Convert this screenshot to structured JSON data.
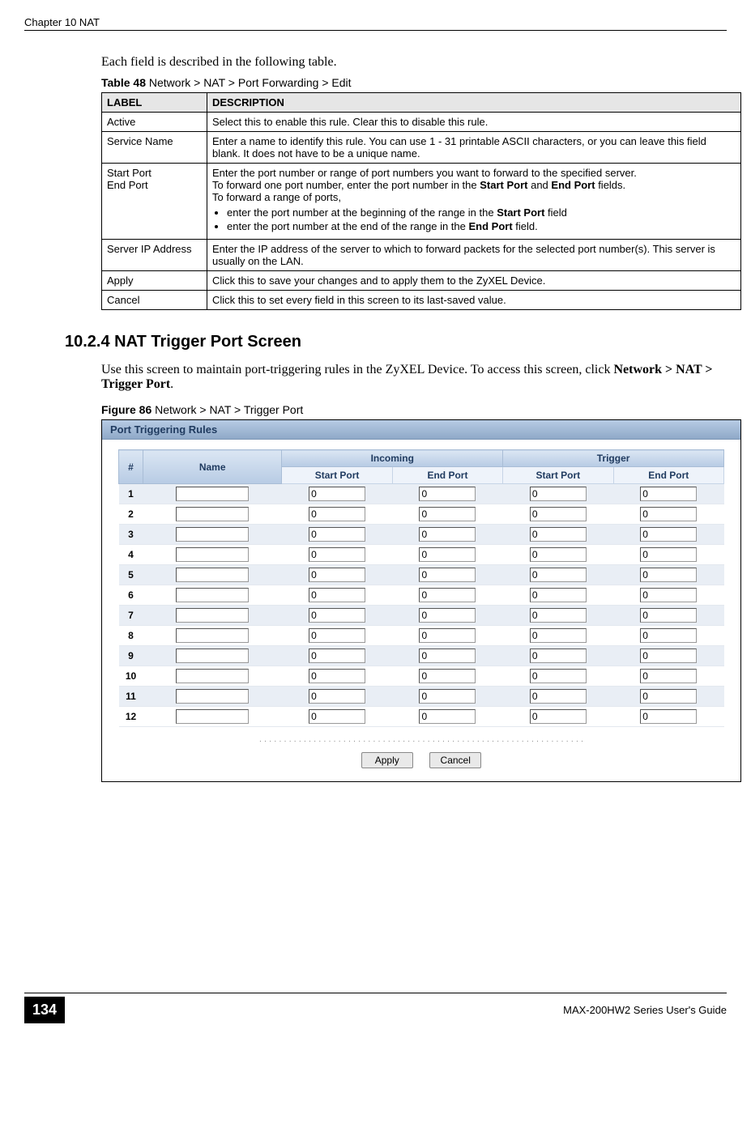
{
  "header": {
    "chapter": "Chapter 10 NAT"
  },
  "intro": "Each field is described in the following table.",
  "table48": {
    "caption_bold": "Table 48",
    "caption_rest": "   Network > NAT > Port Forwarding > Edit",
    "header_label": "LABEL",
    "header_desc": "DESCRIPTION",
    "rows": [
      {
        "label": "Active",
        "desc": "Select this to enable this rule. Clear this to disable this rule."
      },
      {
        "label": "Service Name",
        "desc": "Enter a name to identify this rule. You can use 1 - 31 printable ASCII characters, or you can leave this field blank. It does not have to be a unique name."
      },
      {
        "label": "Start Port\nEnd Port",
        "desc_intro1": "Enter the port number or range of port numbers you want to forward to the specified server.",
        "desc_intro2_pre": "To forward one port number, enter the port number in the ",
        "desc_intro2_b1": "Start Port",
        "desc_intro2_mid": " and ",
        "desc_intro2_b2": "End Port",
        "desc_intro2_post": " fields.",
        "desc_intro3": "To forward a range of ports,",
        "bullet1_pre": "enter the port number at the beginning of the range in the ",
        "bullet1_b": "Start Port",
        "bullet1_post": " field",
        "bullet2_pre": "enter the port number at the end of the range in the ",
        "bullet2_b": "End Port",
        "bullet2_post": " field."
      },
      {
        "label": "Server IP Address",
        "desc": "Enter the IP address of the server to which to forward packets for the selected port number(s). This server is usually on the LAN."
      },
      {
        "label": "Apply",
        "desc": "Click this to save your changes and to apply them to the ZyXEL Device."
      },
      {
        "label": "Cancel",
        "desc": "Click this to set every field in this screen to its last-saved value."
      }
    ]
  },
  "section": {
    "heading": "10.2.4  NAT Trigger Port Screen",
    "para_pre": "Use this screen to maintain port-triggering rules in the ZyXEL Device. To access this screen, click ",
    "para_bold": "Network > NAT > Trigger Port",
    "para_post": "."
  },
  "figure": {
    "caption_bold": "Figure 86",
    "caption_rest": "   Network > NAT > Trigger Port"
  },
  "screenshot": {
    "title": "Port Triggering Rules",
    "cols": {
      "num": "#",
      "name": "Name",
      "incoming": "Incoming",
      "trigger": "Trigger",
      "start_port": "Start Port",
      "end_port": "End Port"
    },
    "rows": [
      {
        "num": "1",
        "name": "",
        "in_start": "0",
        "in_end": "0",
        "tr_start": "0",
        "tr_end": "0"
      },
      {
        "num": "2",
        "name": "",
        "in_start": "0",
        "in_end": "0",
        "tr_start": "0",
        "tr_end": "0"
      },
      {
        "num": "3",
        "name": "",
        "in_start": "0",
        "in_end": "0",
        "tr_start": "0",
        "tr_end": "0"
      },
      {
        "num": "4",
        "name": "",
        "in_start": "0",
        "in_end": "0",
        "tr_start": "0",
        "tr_end": "0"
      },
      {
        "num": "5",
        "name": "",
        "in_start": "0",
        "in_end": "0",
        "tr_start": "0",
        "tr_end": "0"
      },
      {
        "num": "6",
        "name": "",
        "in_start": "0",
        "in_end": "0",
        "tr_start": "0",
        "tr_end": "0"
      },
      {
        "num": "7",
        "name": "",
        "in_start": "0",
        "in_end": "0",
        "tr_start": "0",
        "tr_end": "0"
      },
      {
        "num": "8",
        "name": "",
        "in_start": "0",
        "in_end": "0",
        "tr_start": "0",
        "tr_end": "0"
      },
      {
        "num": "9",
        "name": "",
        "in_start": "0",
        "in_end": "0",
        "tr_start": "0",
        "tr_end": "0"
      },
      {
        "num": "10",
        "name": "",
        "in_start": "0",
        "in_end": "0",
        "tr_start": "0",
        "tr_end": "0"
      },
      {
        "num": "11",
        "name": "",
        "in_start": "0",
        "in_end": "0",
        "tr_start": "0",
        "tr_end": "0"
      },
      {
        "num": "12",
        "name": "",
        "in_start": "0",
        "in_end": "0",
        "tr_start": "0",
        "tr_end": "0"
      }
    ],
    "buttons": {
      "apply": "Apply",
      "cancel": "Cancel"
    }
  },
  "footer": {
    "page": "134",
    "guide": "MAX-200HW2 Series User's Guide"
  }
}
